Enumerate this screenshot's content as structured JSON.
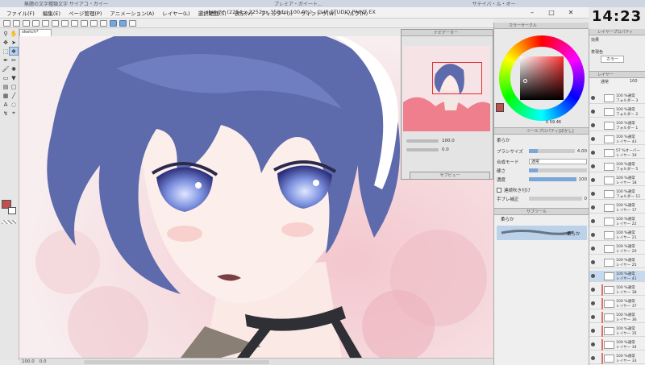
{
  "taskbar_top": [
    "無題の文字種類文字 サイアコ・ガイ一",
    "プレミア・ガイ一ト...",
    "サテイバ・ル・オー"
  ],
  "window": {
    "title": "sketch* (2254 x 2252px 350dpi 100.0%) - CLIP STUDIO PAINT EX",
    "controls": [
      "–",
      "□",
      "✕"
    ]
  },
  "clock": "14:23",
  "menu": [
    "ファイル(F)",
    "編集(E)",
    "ページ管理(P)",
    "アニメーション(A)",
    "レイヤー(L)",
    "選択範囲(S)",
    "表示(V)",
    "フィルター(I)",
    "ウィンドウ(W)",
    "ヘルプ(H)"
  ],
  "canvas": {
    "tab_label": "sketch*",
    "status_zoom": "100.0",
    "status_extra": "0.0"
  },
  "navigator": {
    "header": "ナビゲーター",
    "zoom": "100.0",
    "angle": "0.0"
  },
  "subview": {
    "header": "サブビュー"
  },
  "color_panel": {
    "header": "カラーサークル",
    "selected_color": "#c0504d",
    "hsv": [
      "0",
      "59",
      "46"
    ]
  },
  "tool_property": {
    "header": "ツールプロパティ[ぼかし]",
    "tool_name": "柔らか",
    "brush_size_label": "ブラシサイズ",
    "brush_size": "4.00",
    "blend_mode_label": "合成モード",
    "blend_mode": "通常",
    "hardness_label": "硬さ",
    "density_label": "濃度",
    "density": "100",
    "continuous_label": "連続吹き付け",
    "stabilize_label": "手ブレ補正",
    "stabilize": "0"
  },
  "subtool": {
    "header": "サブツール",
    "group": "柔らか",
    "item_label": "柔らか"
  },
  "layer_property": {
    "header": "レイヤープロパティ",
    "effect_label": "効果",
    "expression_label": "表現色",
    "expression_value": "カラー"
  },
  "layers": {
    "header": "レイヤー",
    "blend": "通常",
    "opacity": "100",
    "rows": [
      {
        "mode": "100 %通常",
        "name": "フォルダー 3",
        "selected": false,
        "clip": false
      },
      {
        "mode": "100 %通常",
        "name": "フォルダー 2",
        "selected": false,
        "clip": false
      },
      {
        "mode": "100 %通常",
        "name": "フォルダー 1",
        "selected": false,
        "clip": false
      },
      {
        "mode": "100 %通常",
        "name": "レイヤー 43",
        "selected": false,
        "clip": false
      },
      {
        "mode": "57 %オーバー",
        "name": "レイヤー 19",
        "selected": false,
        "clip": false
      },
      {
        "mode": "100 %通常",
        "name": "フォルダー 5",
        "selected": false,
        "clip": false
      },
      {
        "mode": "100 %通常",
        "name": "レイヤー 18",
        "selected": false,
        "clip": false
      },
      {
        "mode": "100 %通常",
        "name": "フォルダー 11",
        "selected": false,
        "clip": false
      },
      {
        "mode": "100 %通常",
        "name": "レイヤー 17",
        "selected": false,
        "clip": false
      },
      {
        "mode": "100 %通常",
        "name": "レイヤー 22",
        "selected": false,
        "clip": false
      },
      {
        "mode": "100 %通常",
        "name": "レイヤー 21",
        "selected": false,
        "clip": false
      },
      {
        "mode": "100 %通常",
        "name": "レイヤー 20",
        "selected": false,
        "clip": false
      },
      {
        "mode": "100 %通常",
        "name": "レイヤー 25",
        "selected": false,
        "clip": false
      },
      {
        "mode": "100 %通常",
        "name": "レイヤー 41",
        "selected": true,
        "clip": false
      },
      {
        "mode": "100 %通常",
        "name": "レイヤー 38",
        "selected": false,
        "clip": true
      },
      {
        "mode": "100 %通常",
        "name": "レイヤー 37",
        "selected": false,
        "clip": true
      },
      {
        "mode": "100 %通常",
        "name": "レイヤー 36",
        "selected": false,
        "clip": true
      },
      {
        "mode": "100 %通常",
        "name": "レイヤー 35",
        "selected": false,
        "clip": true
      },
      {
        "mode": "100 %通常",
        "name": "レイヤー 34",
        "selected": false,
        "clip": true
      },
      {
        "mode": "100 %通常",
        "name": "レイヤー 33",
        "selected": false,
        "clip": true
      }
    ]
  }
}
